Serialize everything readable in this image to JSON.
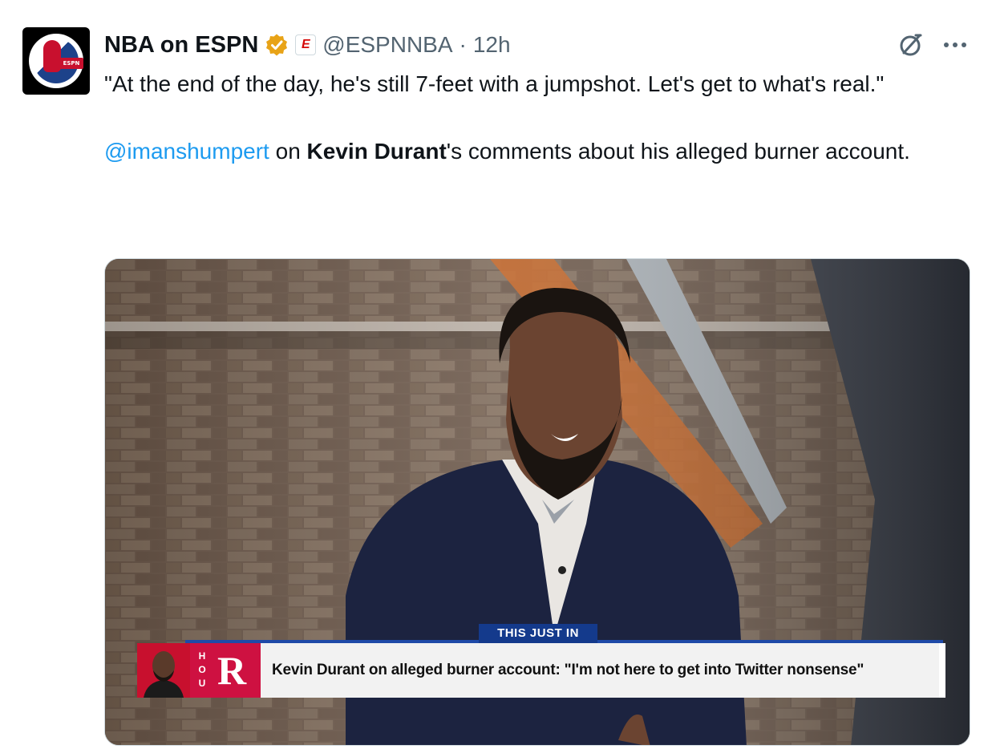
{
  "author": {
    "display_name": "NBA on ESPN",
    "handle": "@ESPNNBA",
    "separator": "·",
    "time": "12h",
    "avatar_label": "ESPN",
    "affiliate_badge": "E"
  },
  "tweet": {
    "line1": "\"At the end of the day, he's still 7-feet with a jumpshot. Let's get to what's real.\"",
    "mention": "@imanshumpert",
    "mention_suffix": " on ",
    "bold_name": "Kevin Durant",
    "rest": "'s comments about his alleged burner account."
  },
  "media": {
    "chyron_label": "THIS JUST IN",
    "team_abbr": [
      "H",
      "O",
      "U"
    ],
    "team_logo": "R",
    "headline": "Kevin Durant on alleged burner account: \"I'm not here to get into Twitter nonsense\""
  },
  "colors": {
    "link": "#1d9bf0",
    "verified": "#e8a317",
    "chyron_blue": "#143a8c",
    "rockets_red": "#ce1141"
  },
  "icons": [
    "verified-icon",
    "grok-icon",
    "more-icon"
  ]
}
